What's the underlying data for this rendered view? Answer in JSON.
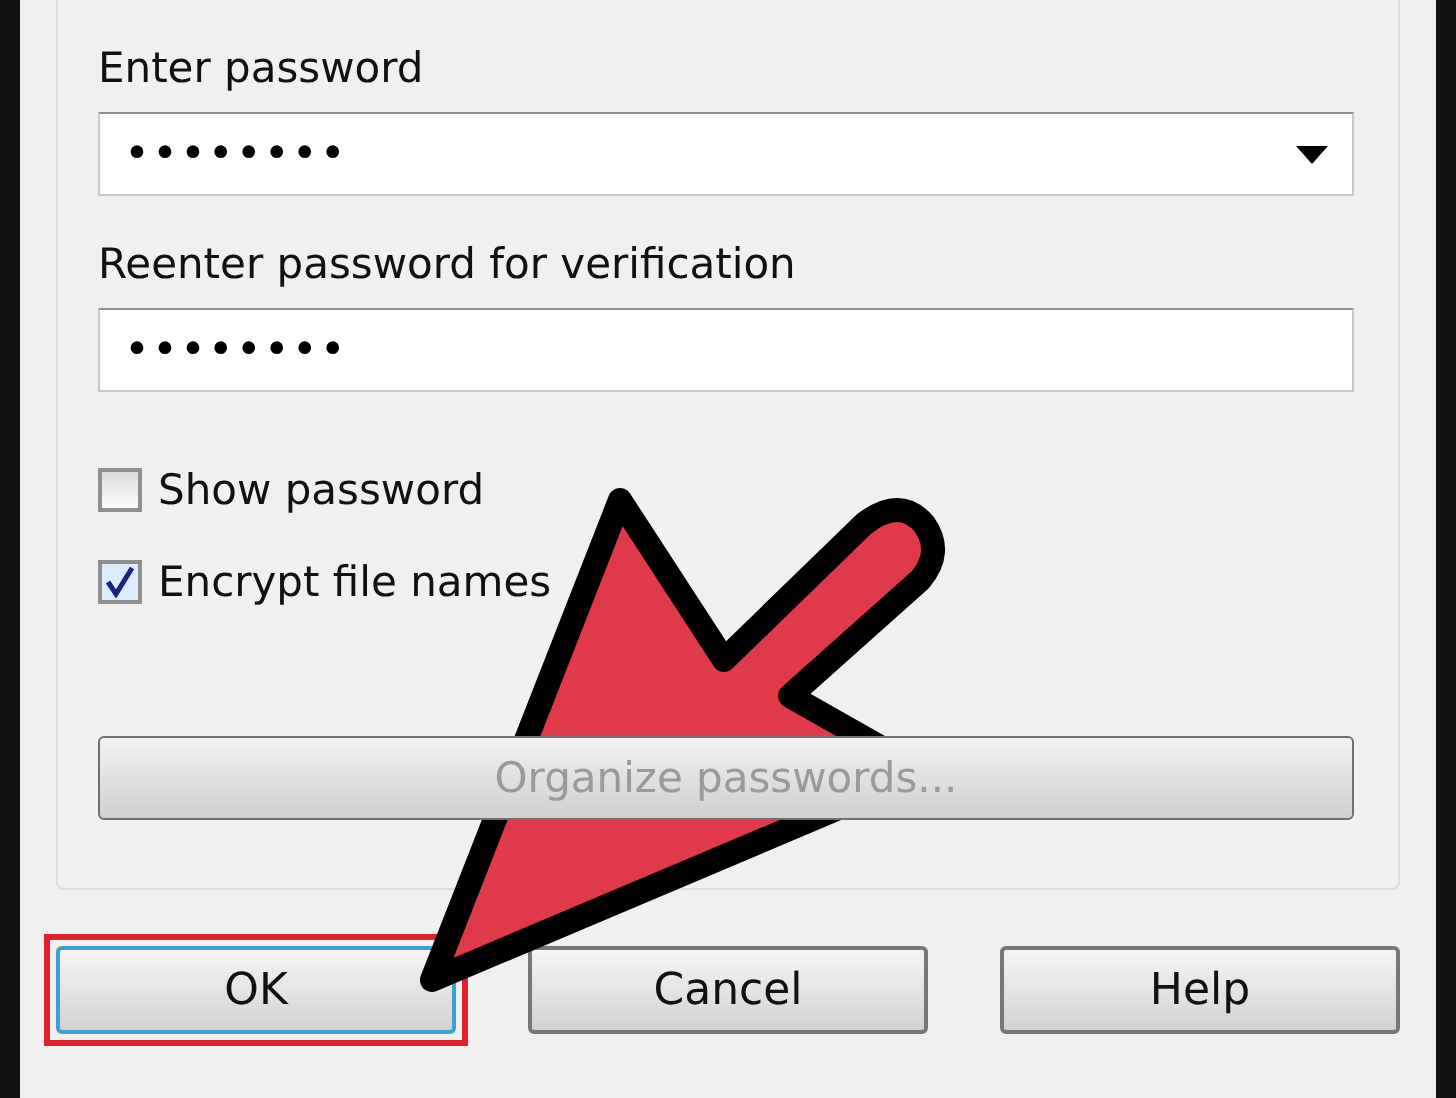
{
  "fields": [
    {
      "label": "Enter password",
      "value": "••••••••",
      "dropdown": true
    },
    {
      "label": "Reenter password for verification",
      "value": "••••••••",
      "dropdown": false
    }
  ],
  "checkboxes": [
    {
      "label": "Show password",
      "checked": false
    },
    {
      "label": "Encrypt file names",
      "checked": true
    }
  ],
  "organize_button": {
    "label": "Organize passwords...",
    "disabled": true
  },
  "buttons": [
    {
      "label": "OK",
      "default": true,
      "highlighted": true
    },
    {
      "label": "Cancel",
      "default": false,
      "highlighted": false
    },
    {
      "label": "Help",
      "default": false,
      "highlighted": false
    }
  ]
}
